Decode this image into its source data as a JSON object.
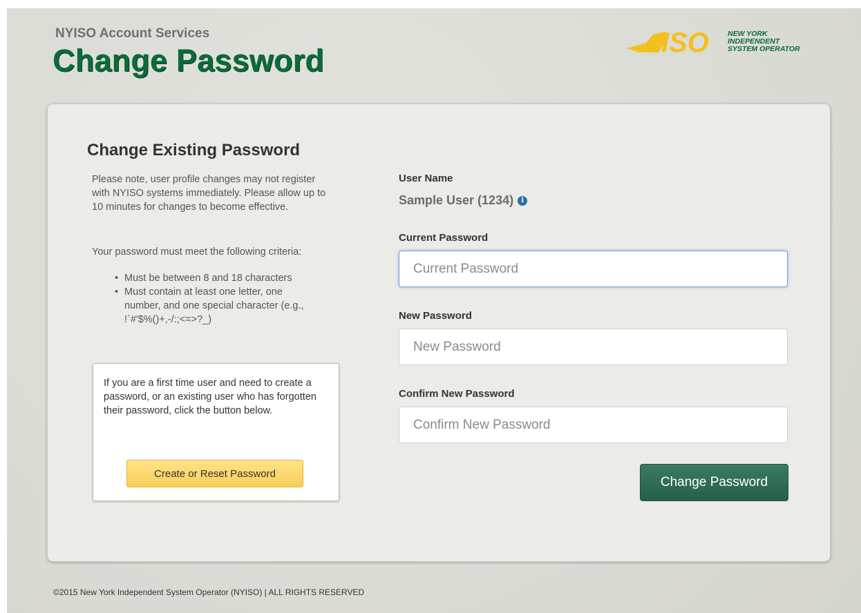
{
  "header": {
    "subtitle": "NYISO Account Services",
    "title": "Change Password",
    "logo": {
      "mark": "ISO",
      "line1": "NEW YORK",
      "line2": "INDEPENDENT",
      "line3": "SYSTEM OPERATOR"
    }
  },
  "left": {
    "heading": "Change Existing Password",
    "note": "Please note, user profile changes may not register with NYISO systems immediately. Please allow up to 10 minutes for changes to become effective.",
    "criteria_intro": "Your password must meet the following criteria:",
    "criteria": [
      "Must be between 8 and 18 characters",
      "Must contain at least one letter, one number, and one special character (e.g., !`#'$%()+,-/:;<=>?_)"
    ],
    "reset_box": {
      "text": "If you are a first time user and need to create a password, or an existing user who has forgotten their password, click the button below.",
      "button_label": "Create or Reset Password"
    }
  },
  "form": {
    "username_label": "User Name",
    "username_value": "Sample User (1234)",
    "current_label": "Current Password",
    "current_placeholder": "Current Password",
    "new_label": "New Password",
    "new_placeholder": "New Password",
    "confirm_label": "Confirm New Password",
    "confirm_placeholder": "Confirm New Password",
    "submit_label": "Change Password"
  },
  "footer": {
    "copyright": "©2015 New York Independent System Operator (NYISO) | ALL RIGHTS RESERVED"
  },
  "colors": {
    "title_green": "#0b6b3a",
    "submit_green": "#2f6e55",
    "reset_yellow": "#fbd96d",
    "logo_yellow": "#f2c01e",
    "logo_green": "#0b6b3a"
  }
}
